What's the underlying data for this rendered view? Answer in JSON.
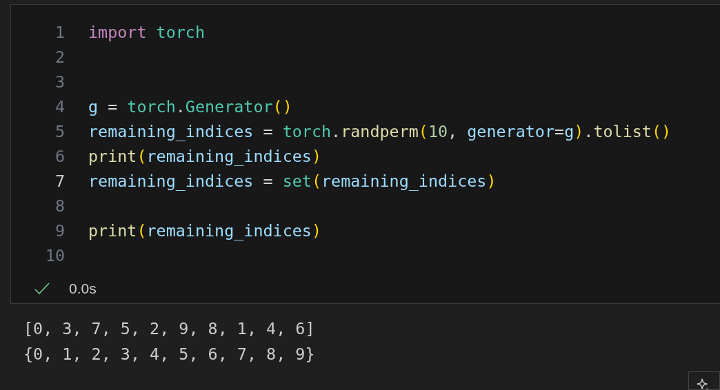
{
  "cell": {
    "lines": [
      {
        "number": "1",
        "current": false,
        "tokens": [
          {
            "kind": "keyword",
            "text": "import "
          },
          {
            "kind": "type",
            "text": "torch"
          }
        ]
      },
      {
        "number": "2",
        "current": false
      },
      {
        "number": "3",
        "current": false
      },
      {
        "number": "4",
        "current": false,
        "tokens": [
          {
            "kind": "var",
            "text": "g"
          },
          {
            "kind": "plain",
            "text": " = "
          },
          {
            "kind": "type",
            "text": "torch"
          },
          {
            "kind": "plain",
            "text": "."
          },
          {
            "kind": "type",
            "text": "Generator"
          },
          {
            "kind": "paren",
            "text": "()"
          }
        ]
      },
      {
        "number": "5",
        "current": false,
        "tokens": [
          {
            "kind": "var",
            "text": "remaining_indices"
          },
          {
            "kind": "plain",
            "text": " = "
          },
          {
            "kind": "type",
            "text": "torch"
          },
          {
            "kind": "plain",
            "text": "."
          },
          {
            "kind": "func",
            "text": "randperm"
          },
          {
            "kind": "paren",
            "text": "("
          },
          {
            "kind": "number",
            "text": "10"
          },
          {
            "kind": "plain",
            "text": ", "
          },
          {
            "kind": "var",
            "text": "generator"
          },
          {
            "kind": "plain",
            "text": "="
          },
          {
            "kind": "var",
            "text": "g"
          },
          {
            "kind": "paren",
            "text": ")"
          },
          {
            "kind": "plain",
            "text": "."
          },
          {
            "kind": "func",
            "text": "tolist"
          },
          {
            "kind": "paren",
            "text": "()"
          }
        ]
      },
      {
        "number": "6",
        "current": false,
        "tokens": [
          {
            "kind": "func",
            "text": "print"
          },
          {
            "kind": "paren",
            "text": "("
          },
          {
            "kind": "var",
            "text": "remaining_indices"
          },
          {
            "kind": "paren",
            "text": ")"
          }
        ]
      },
      {
        "number": "7",
        "current": true,
        "tokens": [
          {
            "kind": "var",
            "text": "remaining_indices"
          },
          {
            "kind": "plain",
            "text": " = "
          },
          {
            "kind": "type",
            "text": "set"
          },
          {
            "kind": "paren",
            "text": "("
          },
          {
            "kind": "var",
            "text": "remaining_indices"
          },
          {
            "kind": "paren",
            "text": ")"
          }
        ]
      },
      {
        "number": "8",
        "current": false
      },
      {
        "number": "9",
        "current": false,
        "tokens": [
          {
            "kind": "func",
            "text": "print"
          },
          {
            "kind": "paren",
            "text": "("
          },
          {
            "kind": "var",
            "text": "remaining_indices"
          },
          {
            "kind": "paren",
            "text": ")"
          }
        ]
      },
      {
        "number": "10",
        "current": false
      }
    ],
    "status": {
      "succeeded": true,
      "duration": "0.0s"
    }
  },
  "output": [
    "[0, 3, 7, 5, 2, 9, 8, 1, 4, 6]",
    "{0, 1, 2, 3, 4, 5, 6, 7, 8, 9}"
  ]
}
